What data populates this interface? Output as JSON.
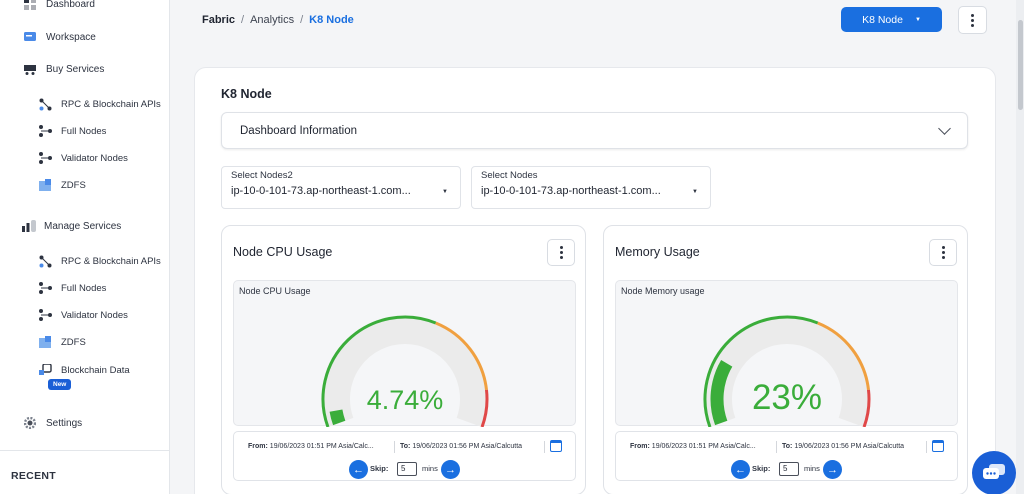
{
  "sidebar": {
    "items": [
      {
        "label": "Dashboard",
        "icon": "grid-icon"
      },
      {
        "label": "Workspace",
        "icon": "folder-icon"
      },
      {
        "label": "Buy Services",
        "icon": "cart-icon"
      },
      {
        "label": "RPC & Blockchain APIs",
        "icon": "branch-icon"
      },
      {
        "label": "Full Nodes",
        "icon": "nodes-icon"
      },
      {
        "label": "Validator Nodes",
        "icon": "nodes-icon"
      },
      {
        "label": "ZDFS",
        "icon": "storage-icon"
      },
      {
        "label": "Manage Services",
        "icon": "bars-icon"
      },
      {
        "label": "RPC & Blockchain APIs",
        "icon": "branch-icon"
      },
      {
        "label": "Full Nodes",
        "icon": "nodes-icon"
      },
      {
        "label": "Validator Nodes",
        "icon": "nodes-icon"
      },
      {
        "label": "ZDFS",
        "icon": "storage-icon"
      },
      {
        "label": "Blockchain Data",
        "icon": "data-icon"
      },
      {
        "label": "Settings",
        "icon": "gear-icon"
      }
    ],
    "new_badge": "New",
    "recent_label": "RECENT"
  },
  "header": {
    "breadcrumb": [
      "Fabric",
      "/",
      "Analytics",
      "/",
      "K8 Node"
    ],
    "node_button": "K8 Node"
  },
  "main": {
    "title": "K8 Node",
    "accordion_label": "Dashboard Information",
    "selects": [
      {
        "label": "Select Nodes2",
        "value": "ip-10-0-101-73.ap-northeast-1.com..."
      },
      {
        "label": "Select Nodes",
        "value": "ip-10-0-101-73.ap-northeast-1.com..."
      }
    ],
    "panels": [
      {
        "title": "Node CPU Usage",
        "gauge_label": "Node CPU Usage",
        "value_text": "4.74%",
        "value": 4.74,
        "from_label": "From:",
        "from_value": "19/06/2023 01:51 PM Asia/Calc...",
        "to_label": "To:",
        "to_value": "19/06/2023 01:56 PM Asia/Calcutta",
        "skip_label": "Skip:",
        "skip_value": "5",
        "mins_label": "mins"
      },
      {
        "title": "Memory Usage",
        "gauge_label": "Node Memory usage",
        "value_text": "23%",
        "value": 23,
        "from_label": "From:",
        "from_value": "19/06/2023 01:51 PM Asia/Calc...",
        "to_label": "To:",
        "to_value": "19/06/2023 01:56 PM Asia/Calcutta",
        "skip_label": "Skip:",
        "skip_value": "5",
        "mins_label": "mins"
      }
    ]
  },
  "colors": {
    "accent": "#1a6fe0",
    "gauge_green": "#3aad3a",
    "gauge_orange": "#f0a040",
    "gauge_red": "#e04848"
  }
}
